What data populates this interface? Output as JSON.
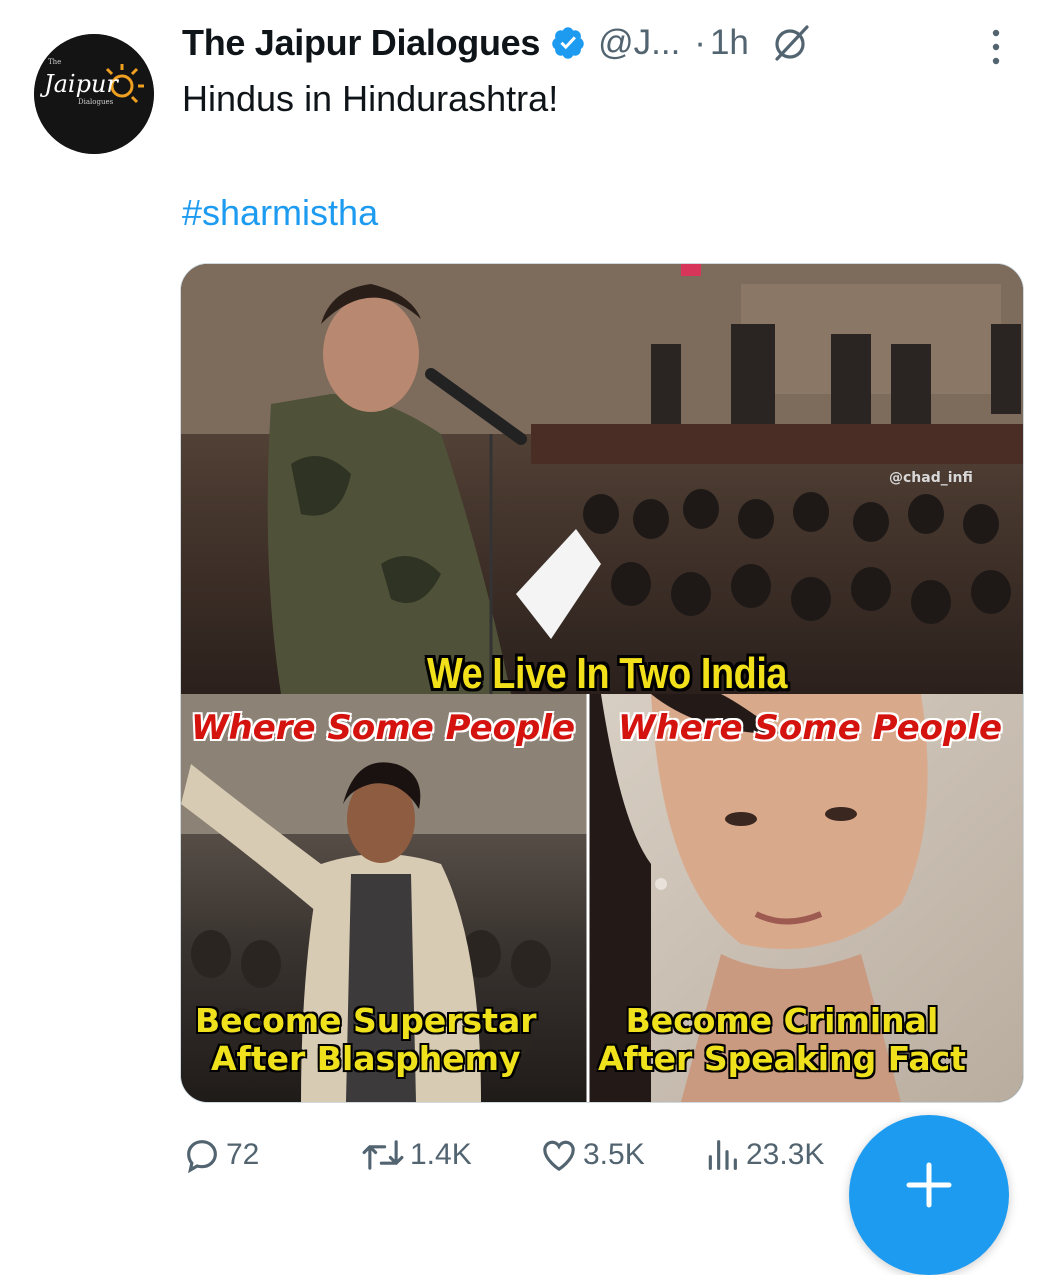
{
  "author": {
    "name": "The Jaipur Dialogues",
    "handle": "@J...",
    "separator": "·",
    "time": "1h",
    "avatar_text": "Jaipur",
    "avatar_small_top": "The",
    "avatar_small_bottom": "Dialogues",
    "verified_color": "#1d9bf0"
  },
  "tweet": {
    "text": "Hindus in Hindurashtra!",
    "hashtag": "#sharmistha"
  },
  "media": {
    "headline": "We Live In Two India",
    "left_top": "Where Some People",
    "right_top": "Where Some People",
    "left_bottom_line1": "Become Superstar",
    "left_bottom_line2": "After Blasphemy",
    "right_bottom_line1": "Become Criminal",
    "right_bottom_line2": "After Speaking Fact",
    "watermark": "@chad_infi"
  },
  "actions": {
    "replies": "72",
    "reposts": "1.4K",
    "likes": "3.5K",
    "views": "23.3K"
  },
  "icons": {
    "reply": "reply-icon",
    "repost": "repost-icon",
    "like": "heart-icon",
    "views": "views-icon",
    "grok": "grok-icon",
    "more": "more-vertical-icon",
    "compose": "plus-icon"
  },
  "colors": {
    "accent": "#1d9bf0",
    "secondary_text": "#536471",
    "headline_yellow": "#f2e11a",
    "caption_red": "#d4130f"
  }
}
